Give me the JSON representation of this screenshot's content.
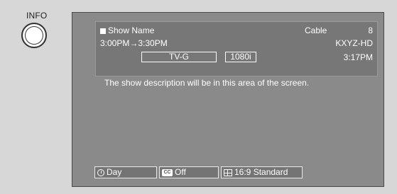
{
  "remote": {
    "info_label": "INFO"
  },
  "banner": {
    "show_name": "Show Name",
    "source": "Cable",
    "channel": "8",
    "time_range": "3:00PM→3:30PM",
    "station": "KXYZ-HD",
    "rating": "TV-G",
    "resolution": "1080i",
    "current_time": "3:17PM"
  },
  "description": "The show description will be in this area of the screen.",
  "bottom_bar": {
    "day_label": "Day",
    "cc_icon_text": "CC",
    "cc_label": "Off",
    "aspect_label": "16:9 Standard"
  },
  "icons": [
    "square-icon",
    "clock-icon",
    "cc-icon",
    "aspect-ratio-icon"
  ]
}
